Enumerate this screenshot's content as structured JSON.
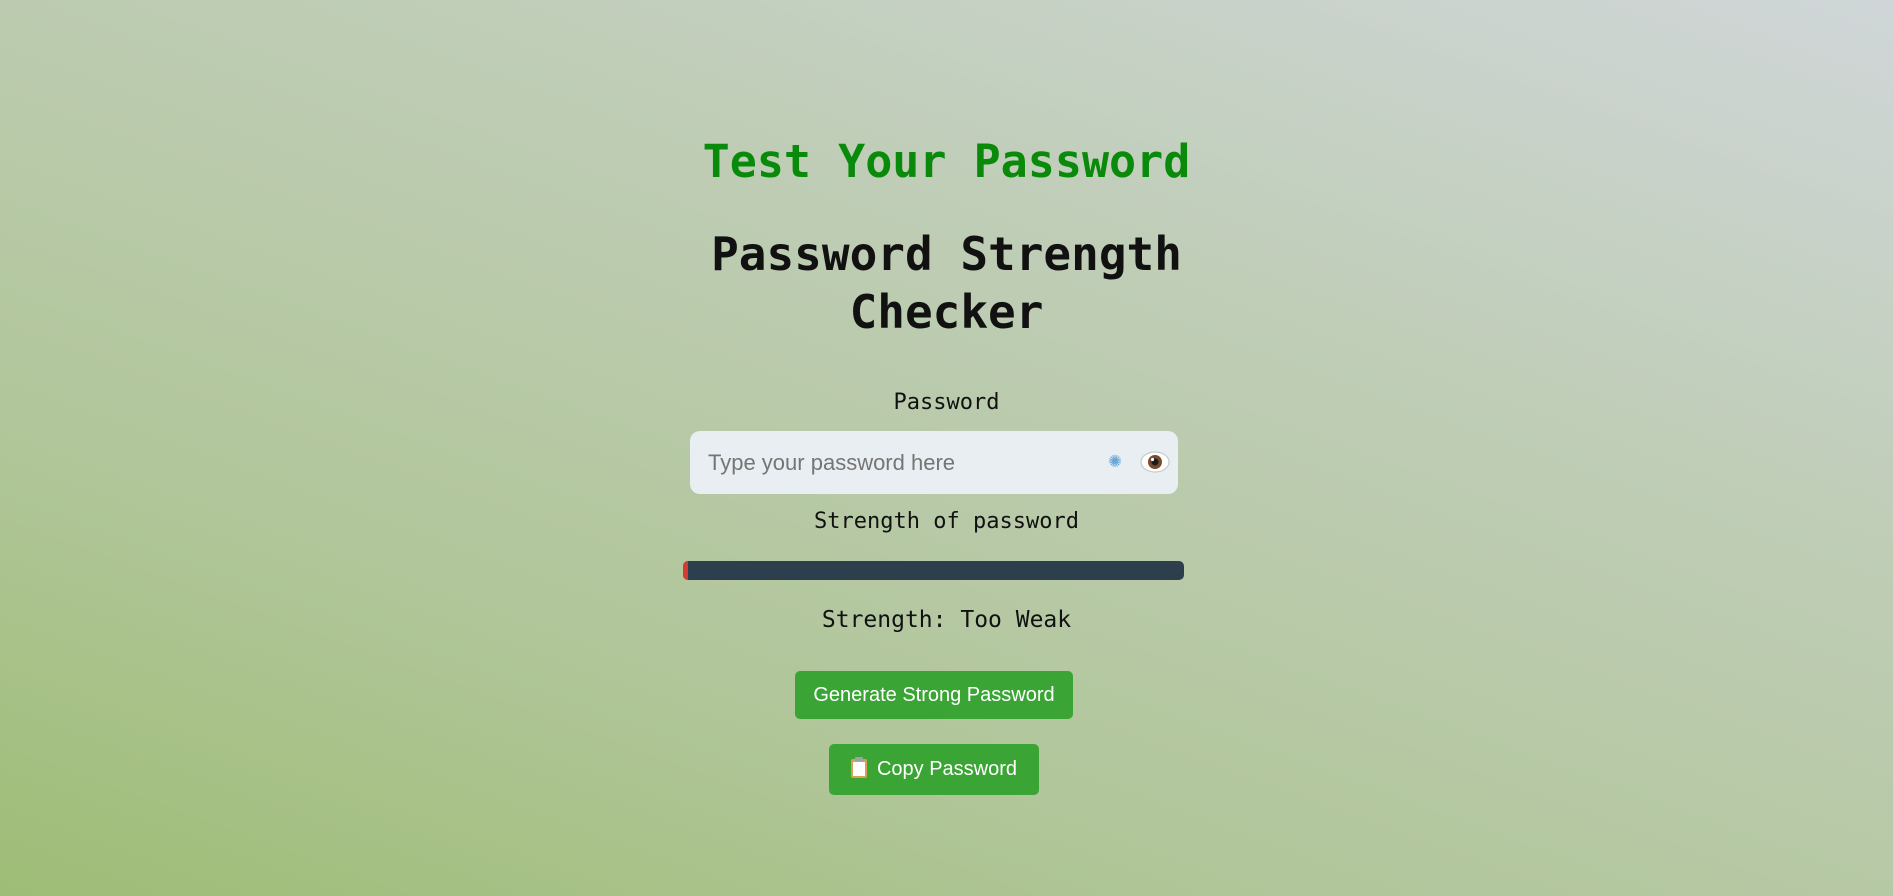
{
  "header": {
    "title": "Test Your Password",
    "subtitle": "Password Strength Checker"
  },
  "form": {
    "password_label": "Password",
    "password_placeholder": "Type your password here",
    "password_value": "",
    "generate_icon": "sparkle-icon",
    "toggle_icon": "eye-icon",
    "strength_label": "Strength of password",
    "strength_text": "Strength: Too Weak",
    "strength_level": 0.01
  },
  "actions": {
    "generate_label": "Generate Strong Password",
    "copy_icon": "clipboard-icon",
    "copy_label": "Copy Password"
  },
  "colors": {
    "title": "#0a8a0a",
    "button": "#3aa535",
    "bar_track": "#2d3f4c",
    "bar_fill_weak": "#d73a32"
  }
}
